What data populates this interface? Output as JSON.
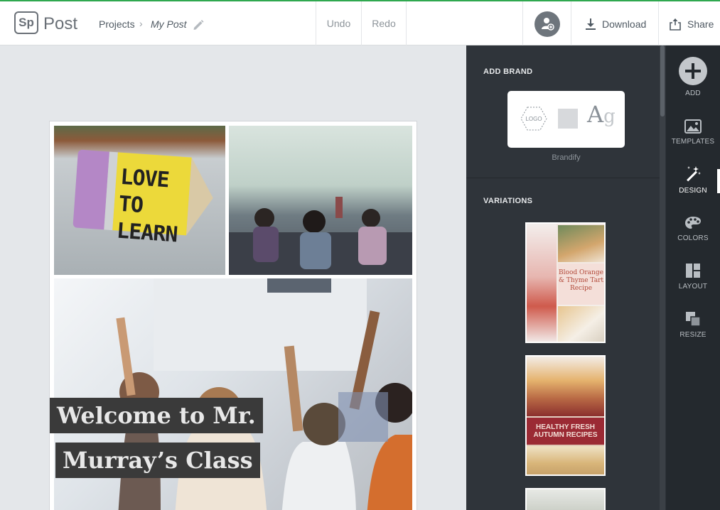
{
  "app": {
    "logo_text": "Sp",
    "name": "Post"
  },
  "header": {
    "breadcrumb_projects": "Projects",
    "breadcrumb_separator": "›",
    "project_name": "My Post",
    "undo_label": "Undo",
    "redo_label": "Redo",
    "download_label": "Download",
    "share_label": "Share"
  },
  "canvas": {
    "pencil_text": "LOVE TO LEARN",
    "banner_line_1": "Welcome to Mr.",
    "banner_line_2": "Murray’s Class"
  },
  "panel": {
    "add_brand_heading": "ADD BRAND",
    "brand_logo_text": "LOGO",
    "brand_font_sample": "A",
    "brand_font_sample_2": "g",
    "brand_caption": "Brandify",
    "variations_heading": "VARIATIONS",
    "variations": [
      {
        "title": "Blood Orange & Thyme Tart Recipe"
      },
      {
        "title": "HEALTHY FRESH AUTUMN RECIPES"
      }
    ]
  },
  "rail": {
    "items": [
      {
        "label": "ADD",
        "icon": "plus-circle-icon"
      },
      {
        "label": "TEMPLATES",
        "icon": "image-icon"
      },
      {
        "label": "DESIGN",
        "icon": "magic-wand-icon",
        "active": true
      },
      {
        "label": "COLORS",
        "icon": "palette-icon"
      },
      {
        "label": "LAYOUT",
        "icon": "layout-icon"
      },
      {
        "label": "RESIZE",
        "icon": "resize-icon"
      }
    ]
  },
  "colors": {
    "accent_top_border": "#2fa84f",
    "panel_bg": "#2f343a",
    "rail_bg": "#24292e",
    "banner_bg": "#3a3a3a"
  }
}
